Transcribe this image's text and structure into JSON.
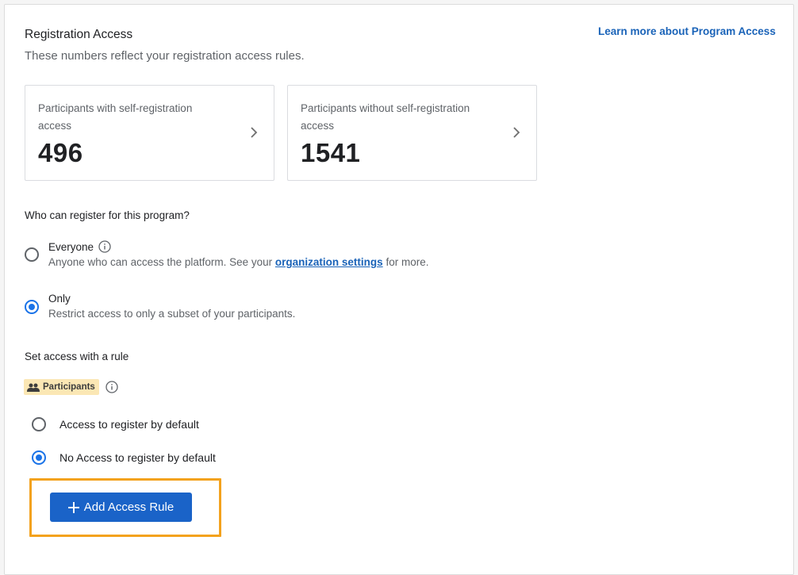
{
  "header": {
    "title": "Registration Access",
    "subtitle": "These numbers reflect your registration access rules.",
    "learn_link": "Learn more about Program Access"
  },
  "cards": [
    {
      "label": "Participants with self-registration access",
      "count": "496"
    },
    {
      "label": "Participants without self-registration access",
      "count": "1541"
    }
  ],
  "who": {
    "question": "Who can register for this program?",
    "everyone": {
      "title": "Everyone",
      "desc_before": "Anyone who can access the platform. See your",
      "link": "organization settings",
      "desc_after": "for more."
    },
    "only": {
      "title": "Only",
      "desc": "Restrict access to only a subset of your participants."
    },
    "selected": "only"
  },
  "rule": {
    "section": "Set access with a rule",
    "badge": "Participants",
    "options": [
      "Access to register by default",
      "No Access to register by default"
    ],
    "selected_index": 1,
    "add_button": "Add Access Rule"
  },
  "colors": {
    "accent": "#1a73e8",
    "button": "#1a63c8",
    "link": "#1a63b8",
    "badge_bg": "#fbe7b4",
    "focus_outline": "#f3a21d"
  }
}
